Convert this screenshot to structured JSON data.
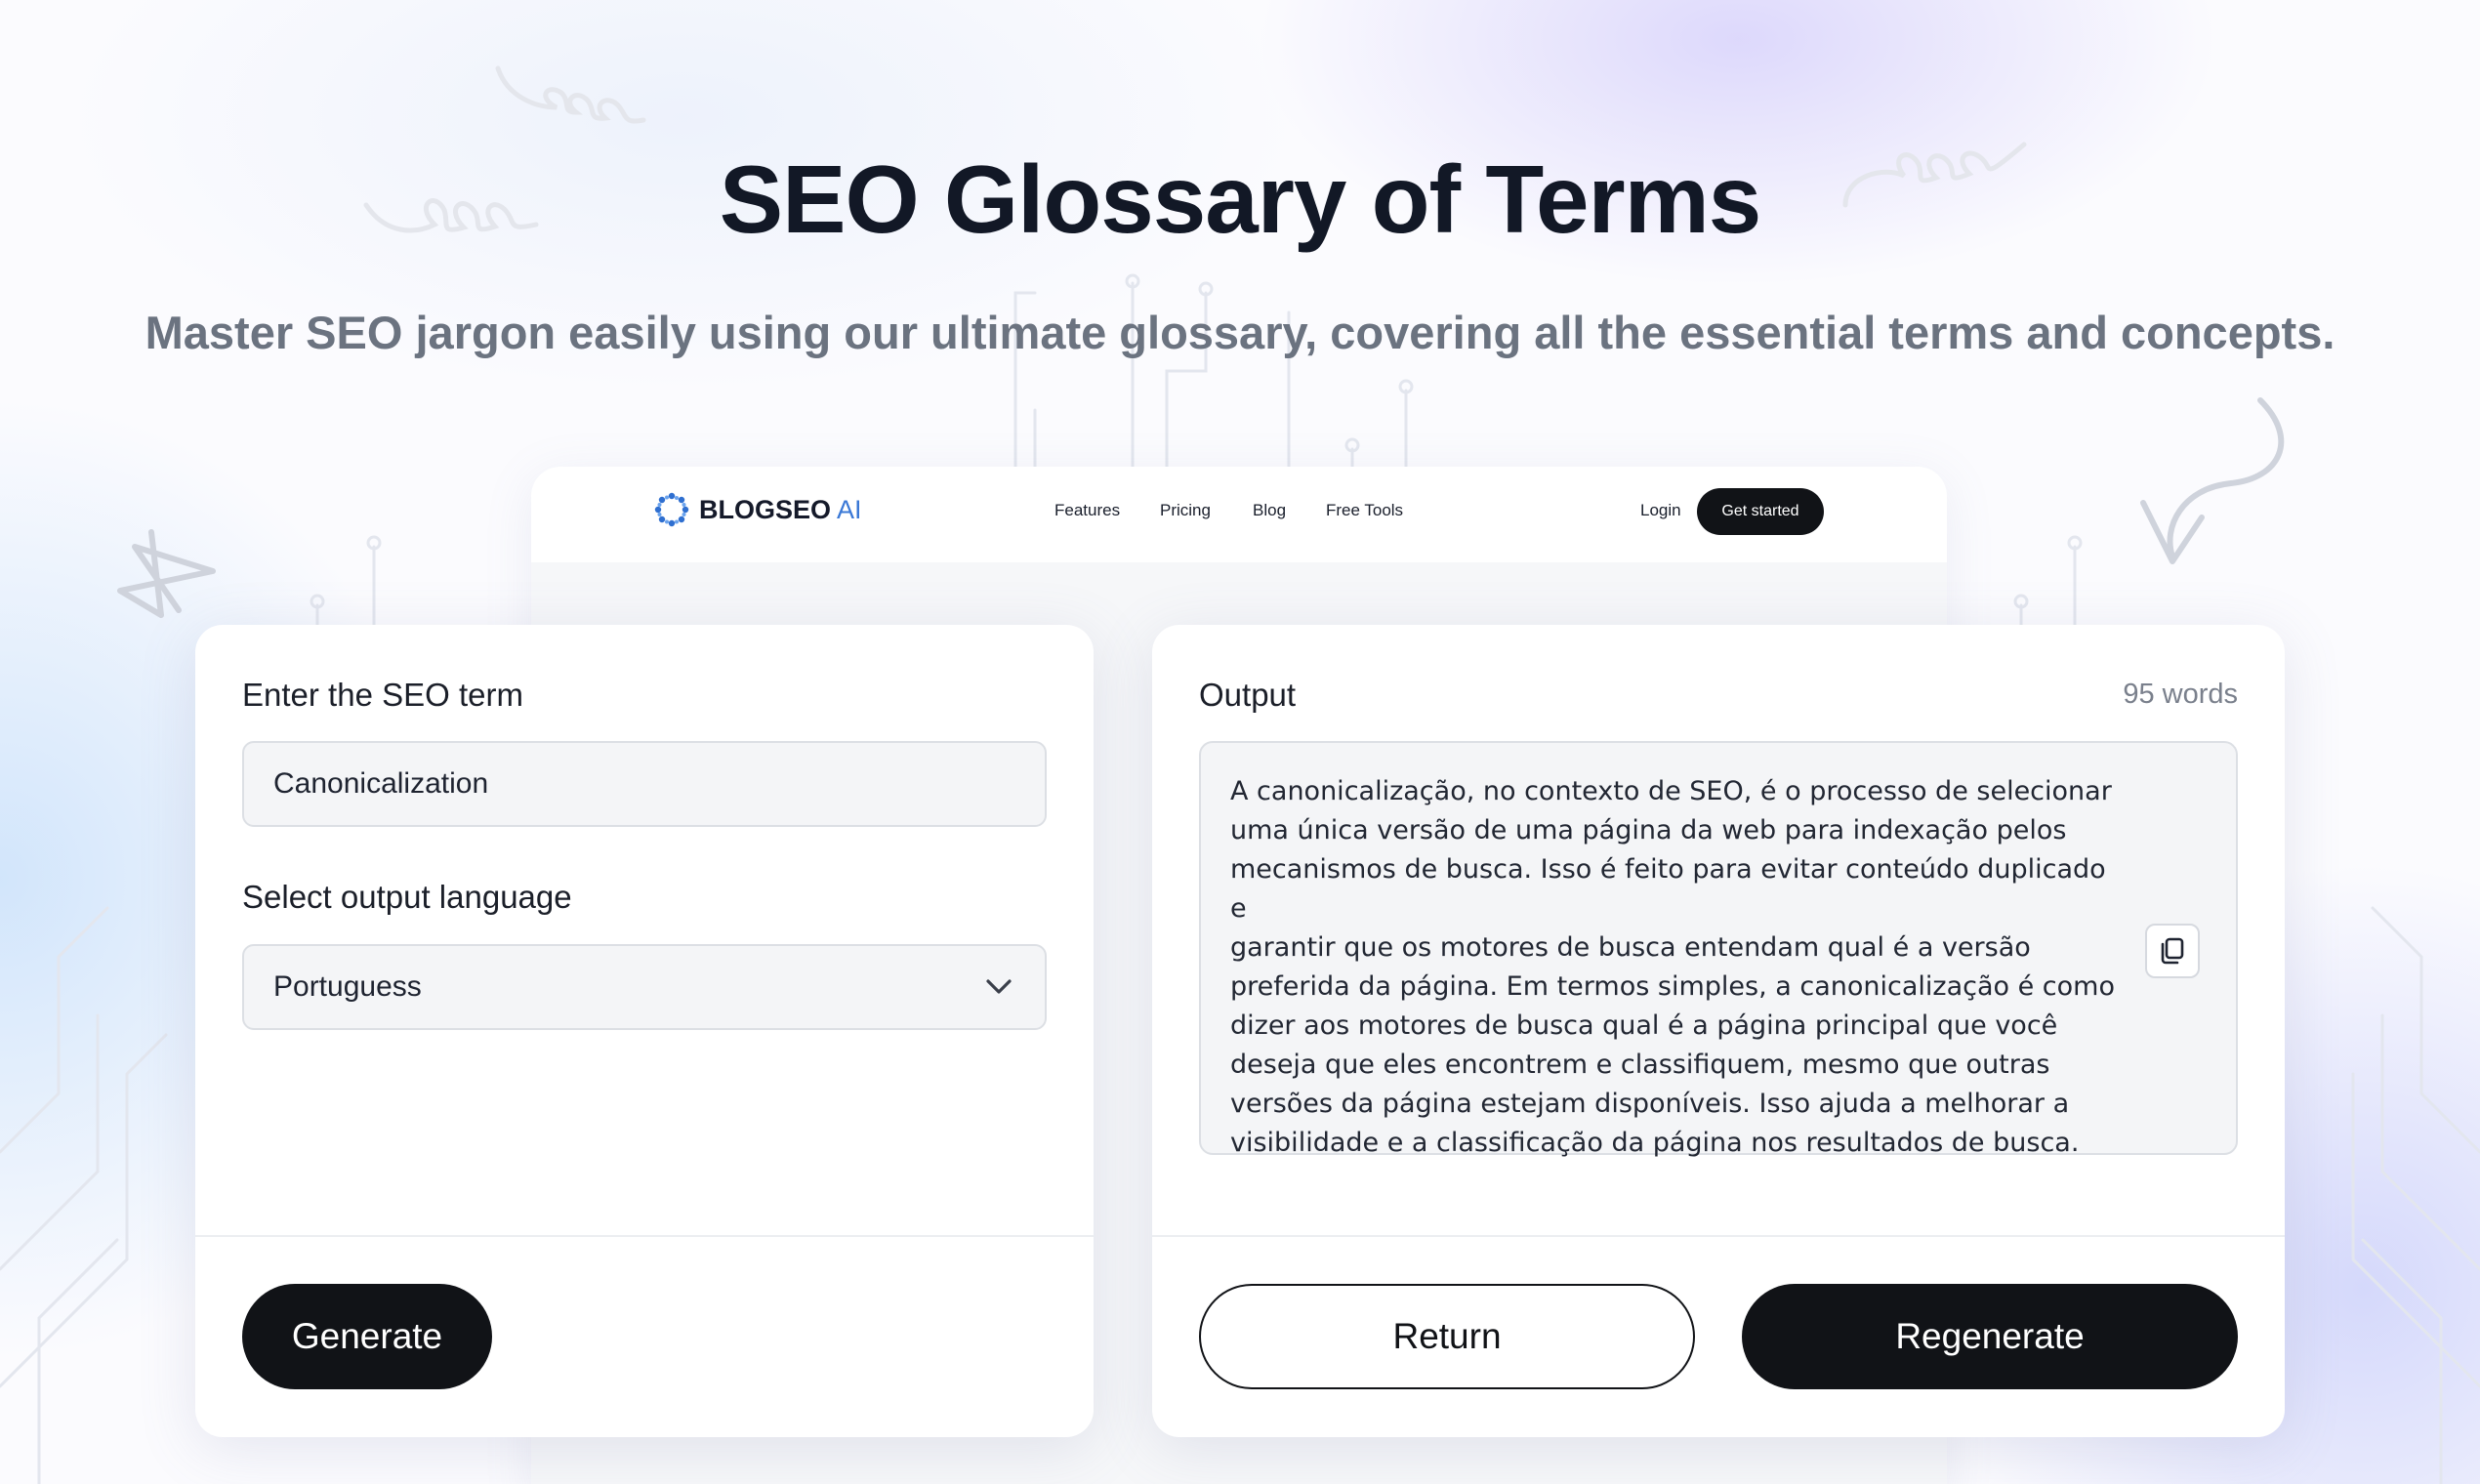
{
  "header": {
    "title": "SEO Glossary of Terms",
    "subtitle": "Master SEO jargon easily using our ultimate glossary, covering all the essential terms and concepts."
  },
  "mock_site": {
    "logo_text": "BLOGSEO",
    "logo_suffix": "AI",
    "nav": [
      "Features",
      "Pricing",
      "Blog",
      "Free Tools"
    ],
    "login": "Login",
    "cta": "Get started"
  },
  "input_panel": {
    "term_label": "Enter the SEO term",
    "term_value": "Canonicalization",
    "language_label": "Select output language",
    "language_value": "Portuguess",
    "generate_label": "Generate"
  },
  "output_panel": {
    "label": "Output",
    "word_count": "95 words",
    "lines": [
      "A canonicalização, no contexto de SEO, é o processo de selecionar",
      "uma única versão de uma página da web para indexação pelos",
      "mecanismos de busca. Isso é feito para evitar conteúdo duplicado e",
      "garantir que os motores de busca entendam qual é a versão",
      "preferida da página. Em termos simples, a canonicalização é como",
      "dizer aos motores de busca qual é a página principal que você",
      "deseja que eles encontrem e classifiquem, mesmo que outras",
      "versões da página estejam disponíveis. Isso ajuda a melhorar a",
      "visibilidade e a classificação da página nos resultados de busca."
    ],
    "return_label": "Return",
    "regenerate_label": "Regenerate"
  },
  "icons": {
    "copy": "copy-icon",
    "chevron": "chevron-down-icon",
    "logo": "blogseo-logo-icon"
  },
  "colors": {
    "primary_dark": "#111317",
    "heading": "#121826",
    "subheading": "#6b7380",
    "brand_accent": "#3a78d6"
  }
}
